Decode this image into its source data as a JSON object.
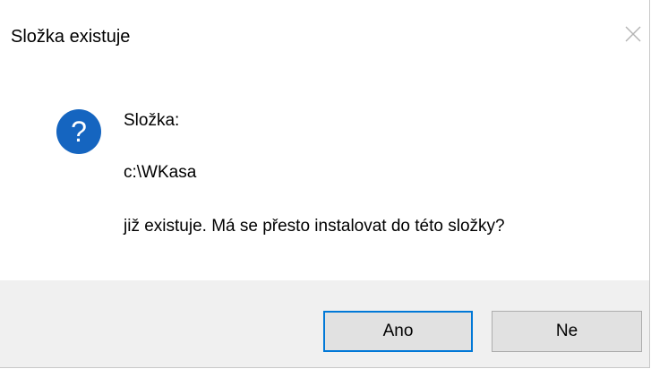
{
  "window": {
    "title": "Složka existuje",
    "close_icon": "close-x-icon"
  },
  "message": {
    "icon": "question-icon",
    "icon_color": "#1565c0",
    "line1": "Složka:",
    "line2": "c:\\WKasa",
    "line3": "již existuje. Má se přesto instalovat do této složky?"
  },
  "buttons": {
    "yes_label": "Ano",
    "no_label": "Ne",
    "focus_color": "#0078d7"
  }
}
